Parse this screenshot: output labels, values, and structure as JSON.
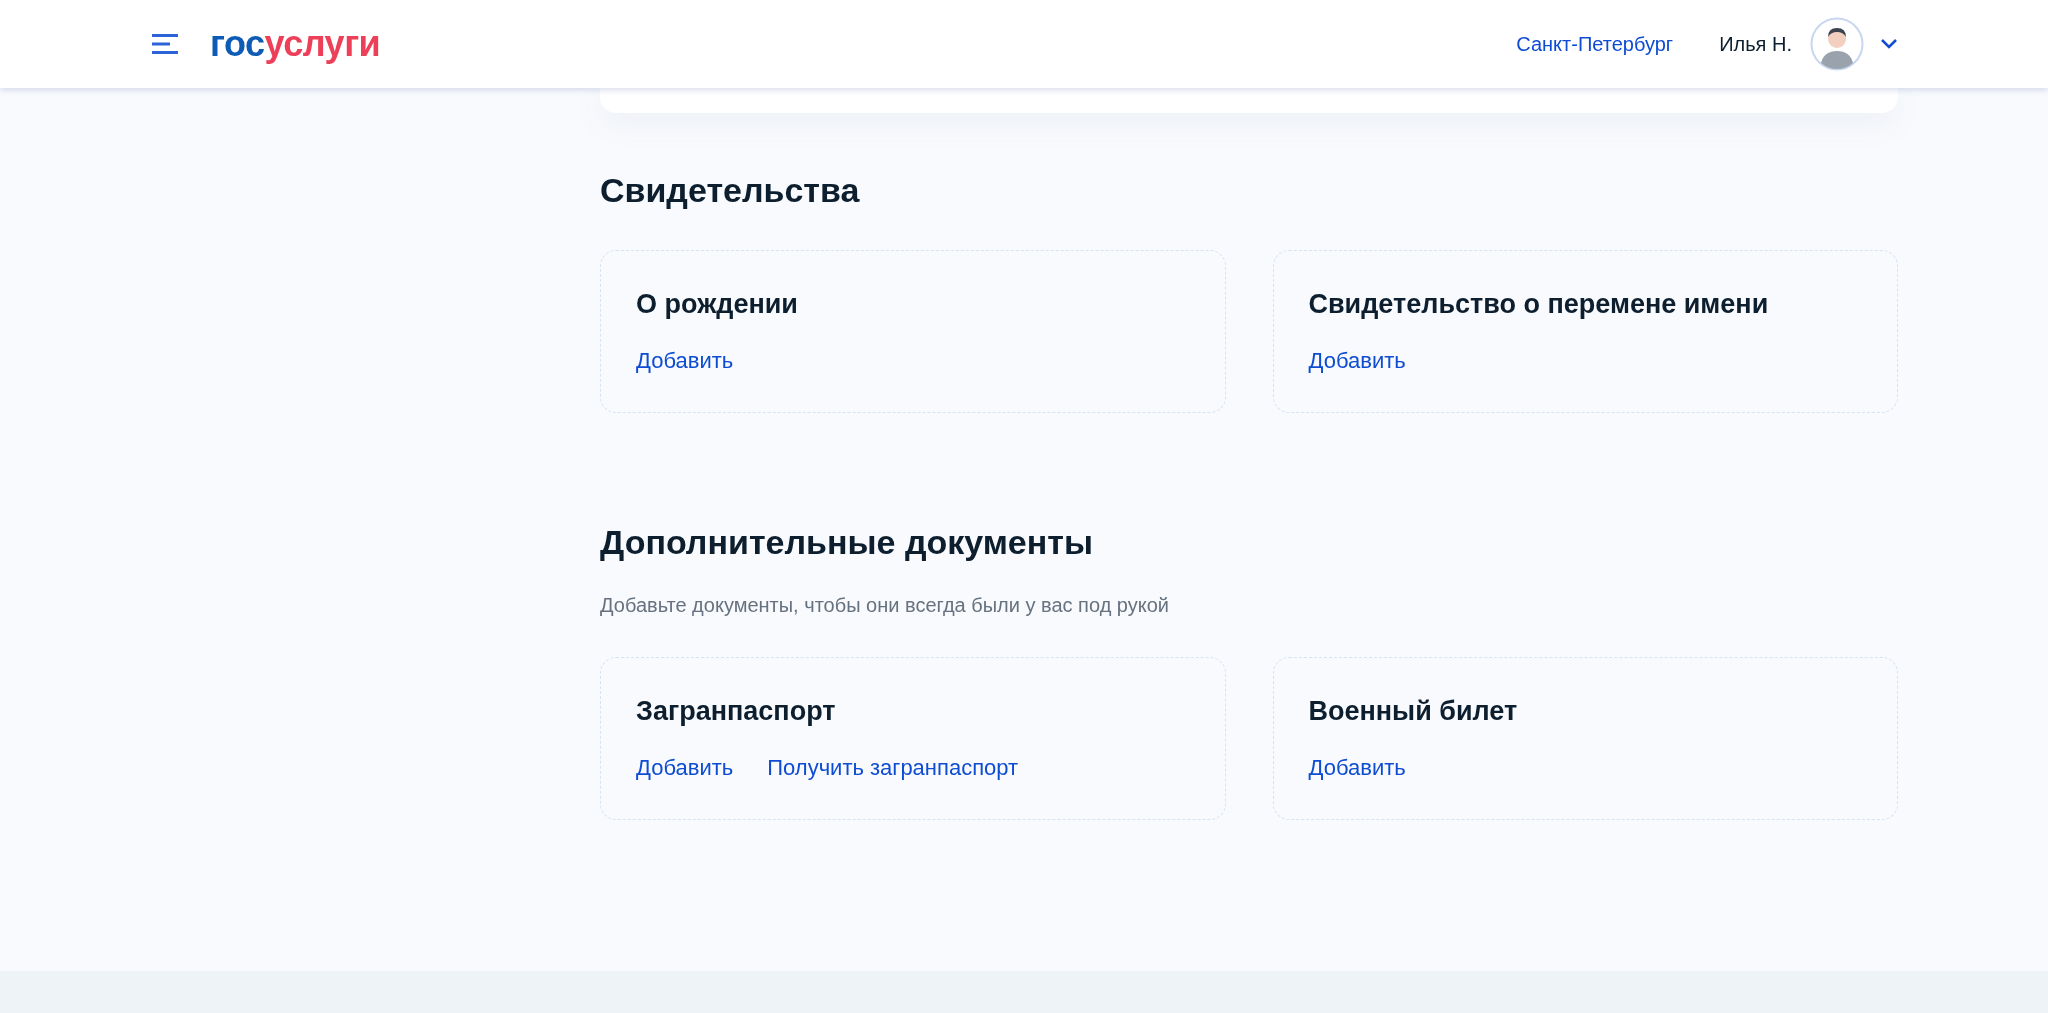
{
  "header": {
    "logo": {
      "prefix": "гос",
      "suffix": "услуги"
    },
    "city": "Санкт-Петербург",
    "user": "Илья Н."
  },
  "sections": [
    {
      "title": "Свидетельства",
      "cards": [
        {
          "title": "О рождении",
          "links": [
            "Добавить"
          ]
        },
        {
          "title": "Свидетельство о перемене имени",
          "links": [
            "Добавить"
          ]
        }
      ]
    },
    {
      "title": "Дополнительные документы",
      "subtitle": "Добавьте документы, чтобы они всегда были у вас под рукой",
      "cards": [
        {
          "title": "Загранпаспорт",
          "links": [
            "Добавить",
            "Получить загранпаспорт"
          ]
        },
        {
          "title": "Военный билет",
          "links": [
            "Добавить"
          ]
        }
      ]
    }
  ]
}
